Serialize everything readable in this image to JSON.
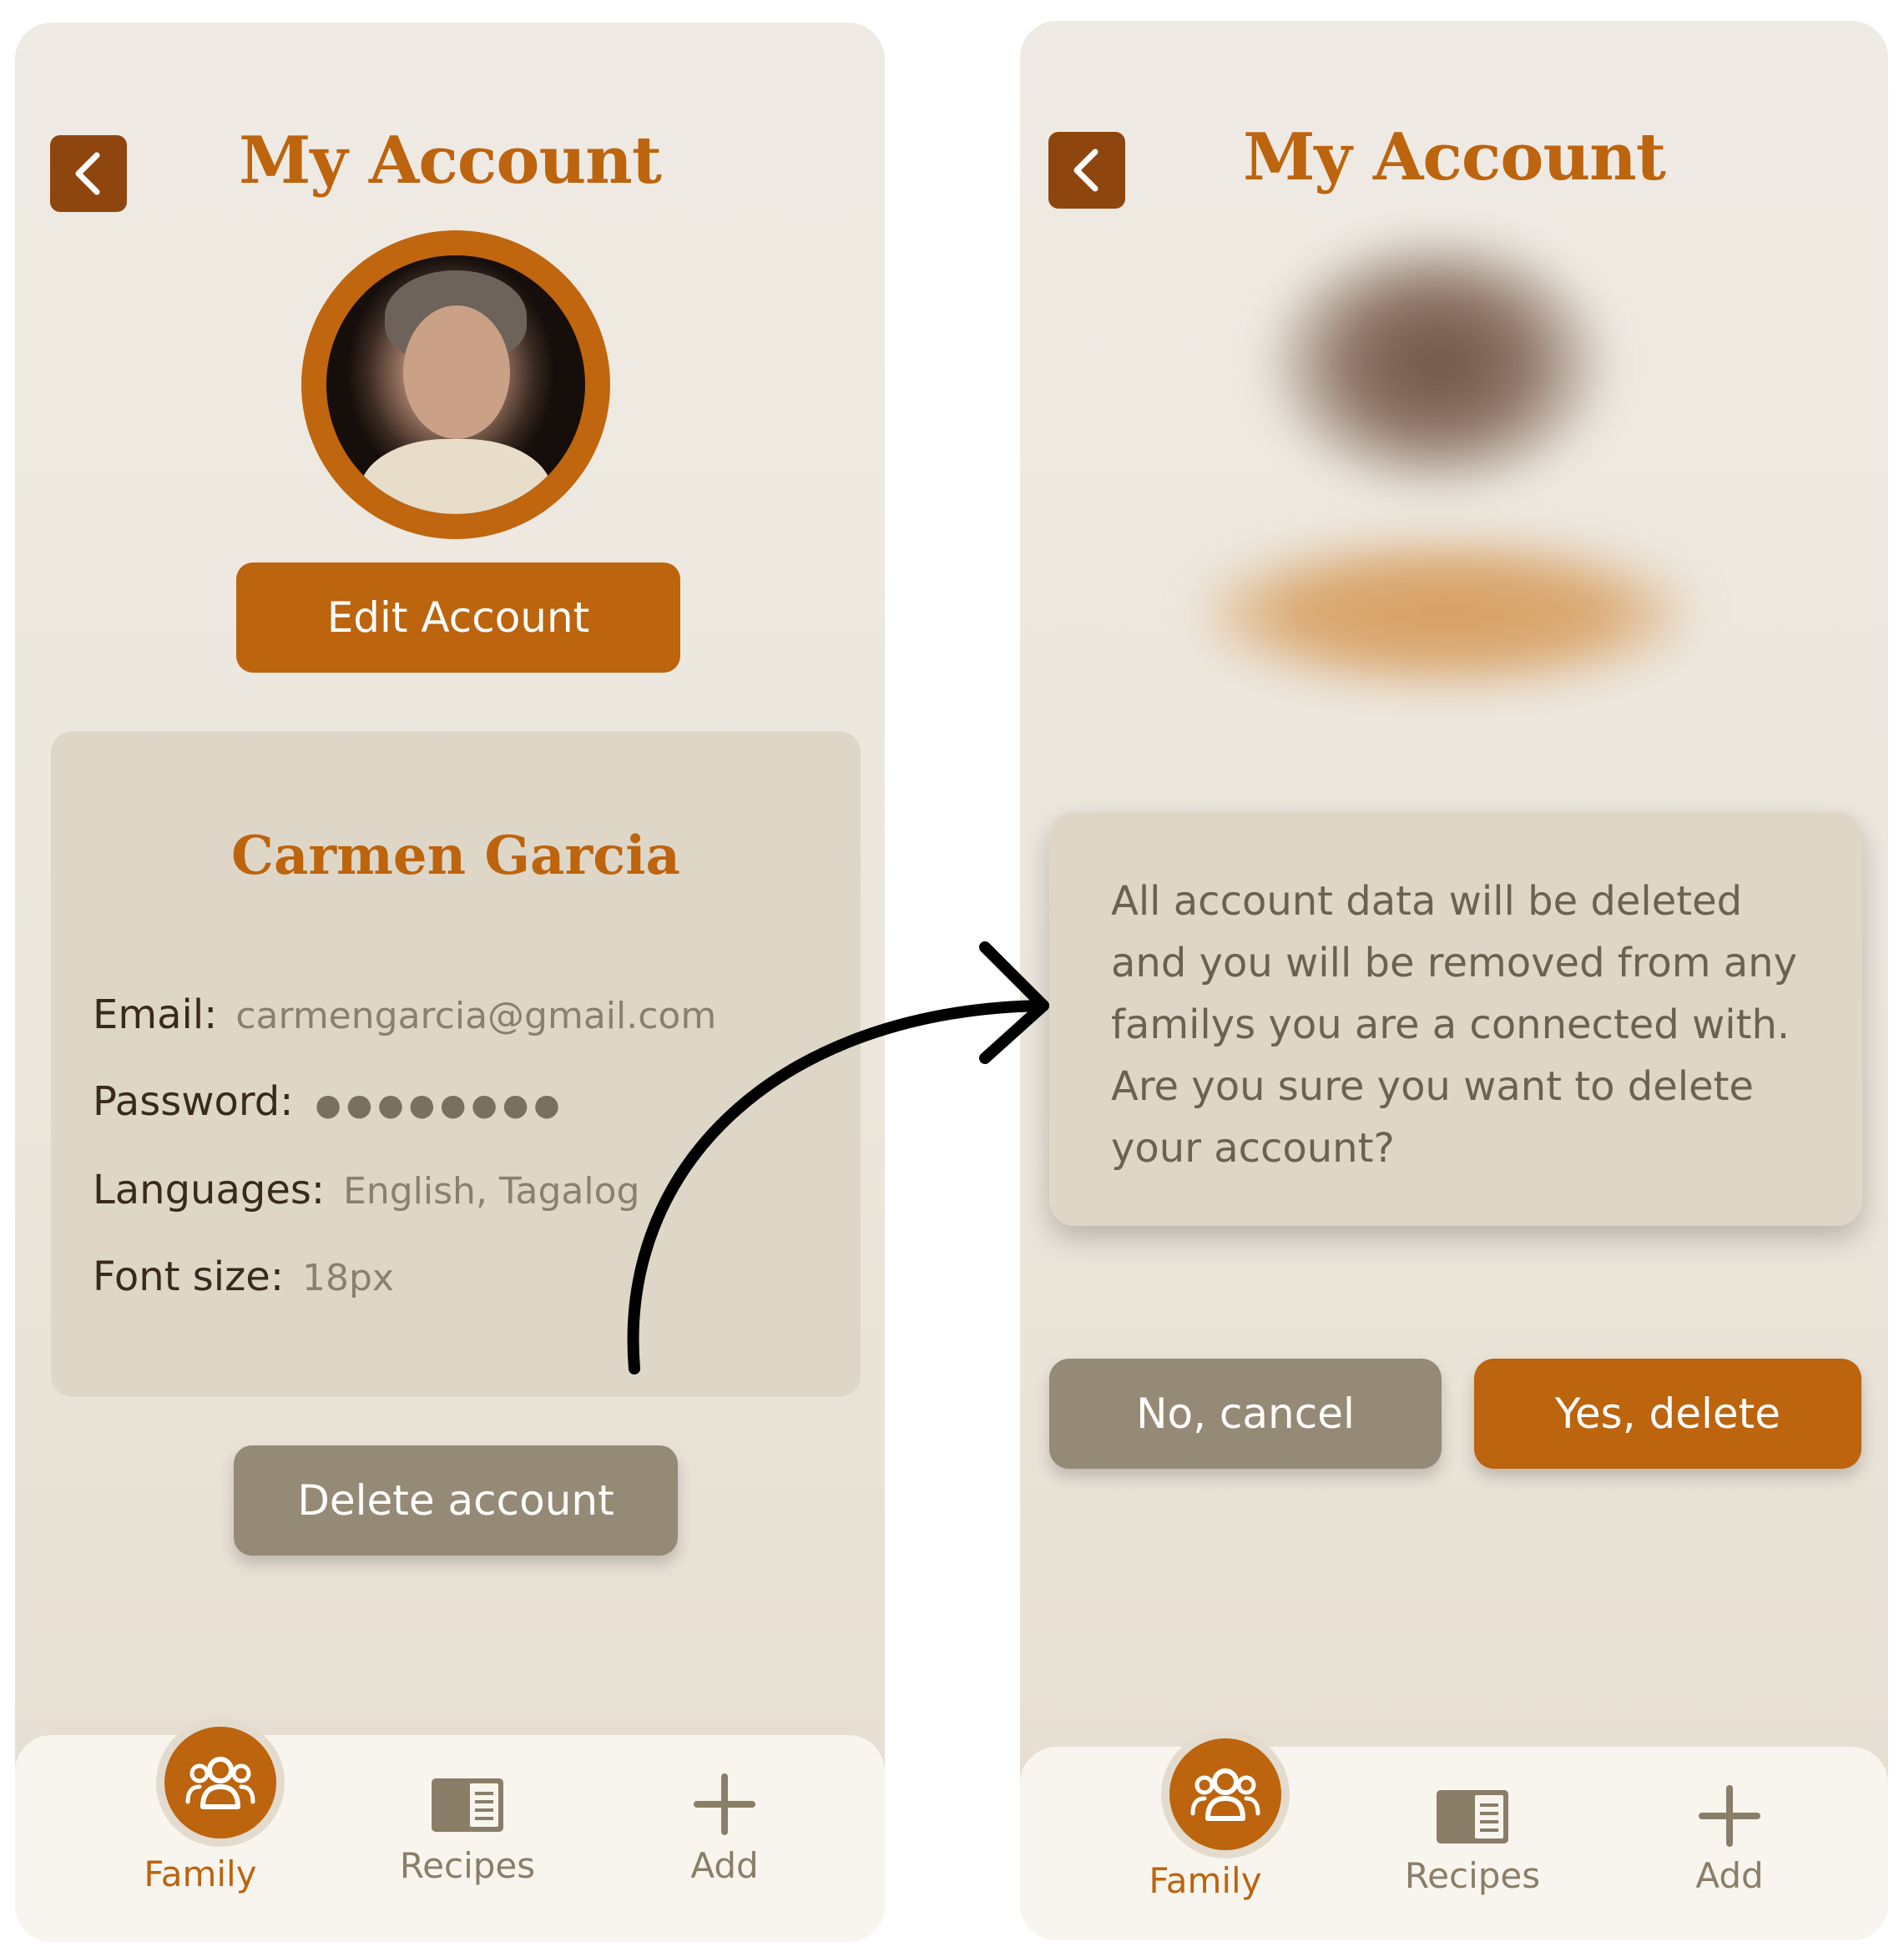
{
  "account_screen": {
    "title": "My Account",
    "edit_button": "Edit Account",
    "name": "Carmen Garcia",
    "fields": [
      {
        "label": "Email:",
        "value": "carmengarcia@gmail.com"
      },
      {
        "label": "Password:",
        "value": "●●●●●●●●"
      },
      {
        "label": "Languages:",
        "value": "English, Tagalog"
      },
      {
        "label": "Font size:",
        "value": "18px"
      }
    ],
    "delete_button": "Delete account"
  },
  "confirm_screen": {
    "title": "My Account",
    "dialog_message": "All account data will be deleted and you will be removed from any familys you are a connected with. Are you sure you want to delete your account?",
    "cancel_button": "No, cancel",
    "confirm_button": "Yes, delete"
  },
  "tabbar": {
    "items": [
      {
        "label": "Family",
        "icon": "family-icon",
        "active": true
      },
      {
        "label": "Recipes",
        "icon": "recipes-book-icon",
        "active": false
      },
      {
        "label": "Add",
        "icon": "plus-icon",
        "active": false
      }
    ]
  },
  "colors": {
    "brand": "#bc640e",
    "back_button": "#8f460e",
    "muted_button": "#958a75",
    "card": "#ded7c8",
    "background": "#efebe4"
  }
}
